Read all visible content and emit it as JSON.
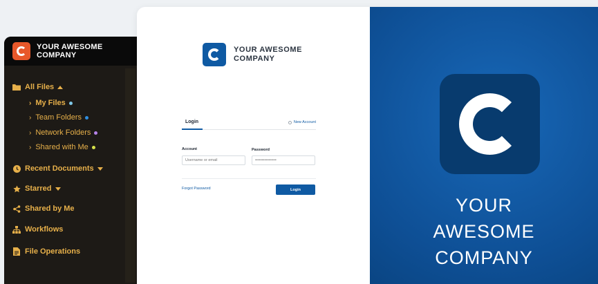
{
  "sidebar": {
    "company_name": "YOUR AWESOME\nCOMPANY",
    "items": [
      {
        "label": "All Files",
        "icon": "folder-icon"
      },
      {
        "label": "Recent Documents",
        "icon": "clock-icon"
      },
      {
        "label": "Starred",
        "icon": "star-icon"
      },
      {
        "label": "Shared by Me",
        "icon": "share-icon"
      },
      {
        "label": "Workflows",
        "icon": "workflow-icon"
      },
      {
        "label": "File Operations",
        "icon": "document-icon"
      }
    ],
    "sub_items": [
      {
        "label": "My Files",
        "dot_color": "#7fc8e8"
      },
      {
        "label": "Team Folders",
        "dot_color": "#2f8fe0"
      },
      {
        "label": "Network Folders",
        "dot_color": "#b583e8"
      },
      {
        "label": "Shared with Me",
        "dot_color": "#d7e24a"
      }
    ],
    "accent_color": "#e7b04a"
  },
  "login": {
    "company_name": "YOUR AWESOME\nCOMPANY",
    "tab_login": "Login",
    "tab_new_account": "New Account",
    "account_label": "Account",
    "account_placeholder": "Username or email",
    "password_label": "Password",
    "password_placeholder": "••••••••••••••••",
    "forgot_link": "Forgot Password",
    "login_button": "Login"
  },
  "brand_panel": {
    "company_name": "YOUR\nAWESOME\nCOMPANY",
    "background_color": "#0e4f95"
  }
}
